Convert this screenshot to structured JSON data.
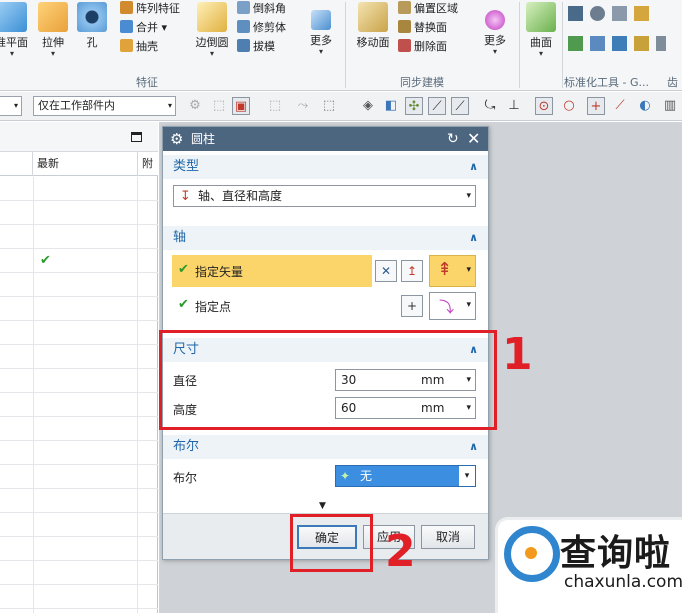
{
  "ribbon": {
    "big_buttons": [
      {
        "label": "基准平面",
        "icon": "datum-plane-icon",
        "color": "#3b8fd6"
      },
      {
        "label": "拉伸",
        "icon": "extrude-icon",
        "color": "#e8a13a"
      },
      {
        "label": "孔",
        "icon": "hole-icon",
        "color": "#5a9bd5"
      },
      {
        "label": "边倒圆",
        "icon": "edge-blend-icon",
        "color": "#e0b040"
      },
      {
        "label": "更多",
        "icon": "more-features-icon",
        "color": "#4a8fd0"
      },
      {
        "label": "移动面",
        "icon": "move-face-icon",
        "color": "#c9a34a"
      },
      {
        "label": "更多",
        "icon": "more-sync-icon",
        "color": "#c23cc2"
      },
      {
        "label": "曲面",
        "icon": "surface-icon",
        "color": "#6ab04c"
      }
    ],
    "small_buttons": [
      {
        "label": "阵列特征",
        "icon": "pattern-feature-icon"
      },
      {
        "label": "合并 ▾",
        "icon": "unite-icon"
      },
      {
        "label": "抽壳",
        "icon": "shell-icon"
      },
      {
        "label": "倒斜角",
        "icon": "chamfer-icon"
      },
      {
        "label": "修剪体",
        "icon": "trim-body-icon"
      },
      {
        "label": "拔模",
        "icon": "draft-icon"
      },
      {
        "label": "偏置区域",
        "icon": "offset-region-icon"
      },
      {
        "label": "替换面",
        "icon": "replace-face-icon"
      },
      {
        "label": "删除面",
        "icon": "delete-face-icon"
      }
    ],
    "groups": [
      "特征",
      "同步建模",
      "标准化工具 - G...",
      "齿"
    ]
  },
  "selbar": {
    "filter_value": "仅在工作部件内"
  },
  "navigator": {
    "col_latest": "最新",
    "col_extra": "附",
    "rows": [
      "",
      "",
      "",
      "✔",
      "",
      "",
      "",
      "",
      "",
      "",
      "",
      "",
      "",
      "",
      "",
      "",
      "",
      "",
      ""
    ]
  },
  "dialog": {
    "title": "圆柱",
    "sections": {
      "type": {
        "header": "类型",
        "selected": "轴、直径和高度"
      },
      "axis": {
        "header": "轴",
        "specify_vector": "指定矢量",
        "specify_point": "指定点"
      },
      "dimensions": {
        "header": "尺寸",
        "diameter_label": "直径",
        "diameter_value": "30",
        "diameter_unit": "mm",
        "height_label": "高度",
        "height_value": "60",
        "height_unit": "mm"
      },
      "boolean": {
        "header": "布尔",
        "label": "布尔",
        "value": "无"
      }
    },
    "buttons": {
      "ok": "确定",
      "apply": "应用",
      "cancel": "取消"
    }
  },
  "annotations": {
    "marker_1": "1",
    "marker_2": "2",
    "color": "#e01f26"
  },
  "watermark": {
    "cn": "查询啦",
    "en": "chaxunla.com"
  }
}
